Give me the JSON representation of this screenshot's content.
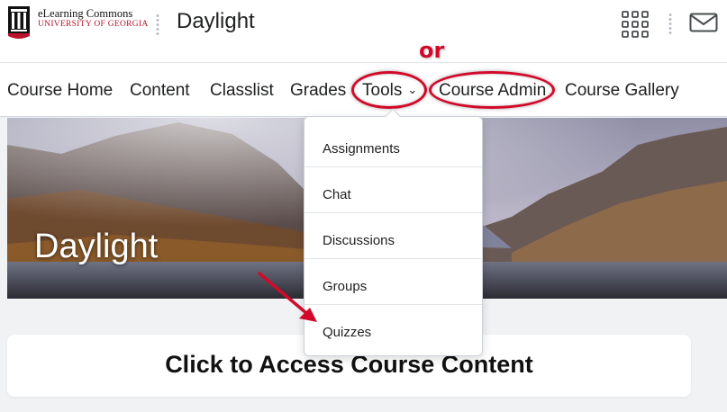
{
  "header": {
    "logo": {
      "line1": "eLearning Commons",
      "line2": "UNIVERSITY OF GEORGIA",
      "arch_color": "#b8132b"
    },
    "course_title": "Daylight",
    "apps_icon": "waffle-grid-icon",
    "messages_icon": "envelope-icon"
  },
  "nav": {
    "items": [
      {
        "label": "Course Home"
      },
      {
        "label": "Content"
      },
      {
        "label": "Classlist"
      },
      {
        "label": "Grades"
      },
      {
        "label": "Tools",
        "has_dropdown": true,
        "highlighted": true
      },
      {
        "label": "Course Admin",
        "highlighted": true
      },
      {
        "label": "Course Gallery"
      }
    ],
    "annotation_text": "or",
    "annotation_color": "#d10a2a"
  },
  "tools_menu": {
    "items": [
      {
        "label": "Assignments"
      },
      {
        "label": "Chat"
      },
      {
        "label": "Discussions"
      },
      {
        "label": "Groups"
      },
      {
        "label": "Quizzes",
        "pointed_by_arrow": true
      }
    ]
  },
  "banner": {
    "title": "Daylight"
  },
  "content_card": {
    "label": "Click to Access Course Content"
  }
}
